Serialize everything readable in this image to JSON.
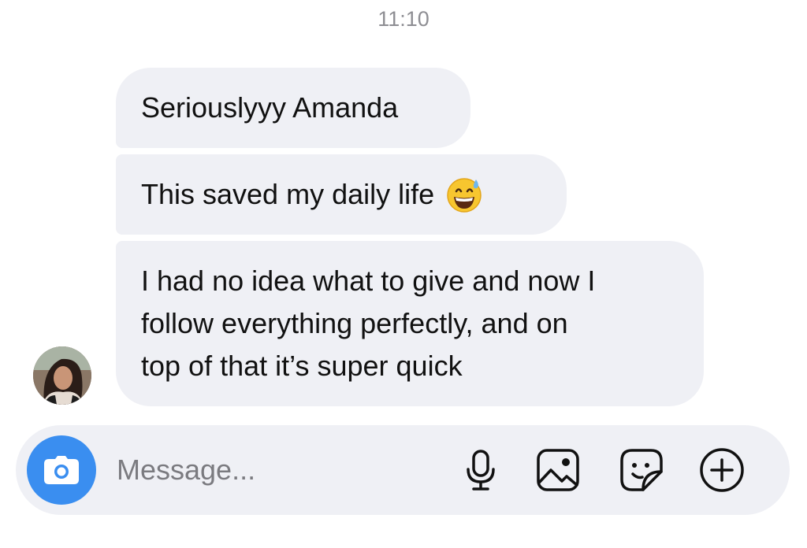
{
  "header": {
    "time": "11:10"
  },
  "messages": [
    {
      "text": "Seriouslyyy Amanda"
    },
    {
      "text": "This saved my daily life",
      "emoji": "grinning-face-with-sweat-icon"
    },
    {
      "lines": [
        "I had no idea what to give and now I",
        "follow everything perfectly, and on",
        "top of that it’s super quick"
      ]
    }
  ],
  "sender": {
    "avatar_icon": "profile-photo"
  },
  "composer": {
    "placeholder": "Message...",
    "camera_icon": "camera-icon",
    "mic_icon": "microphone-icon",
    "gallery_icon": "image-icon",
    "sticker_icon": "sticker-icon",
    "plus_icon": "plus-circle-icon",
    "accent_color": "#3a8ef0"
  }
}
